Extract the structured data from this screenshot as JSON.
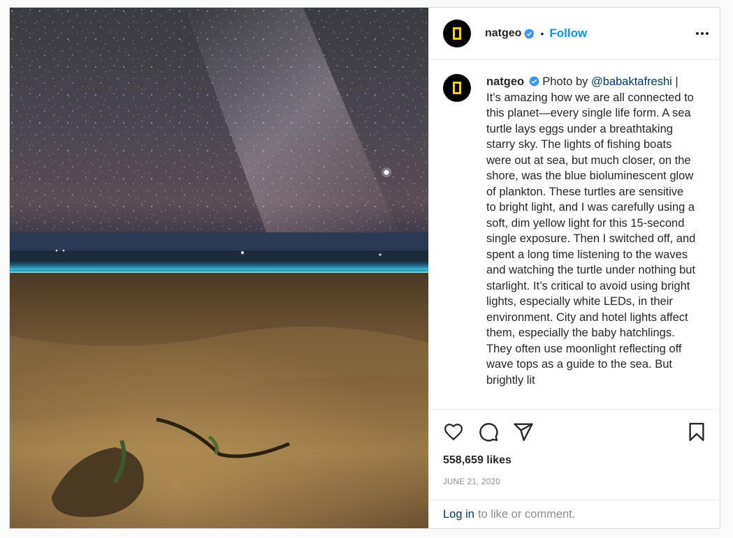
{
  "post": {
    "username": "natgeo",
    "follow_label": "Follow",
    "separator": "•",
    "caption": {
      "username": "natgeo",
      "prefix": "Photo by",
      "mention": "@babaktafreshi",
      "text": " | It’s amazing how we are all connected to this planet—every single life form. A sea turtle lays eggs under a breathtaking starry sky. The lights of fishing boats were out at sea, but much closer, on the shore, was the blue bioluminescent glow of plankton. These turtles are sensitive to bright light, and I was carefully using a soft, dim yellow light for this 15-second single exposure. Then I switched off, and spent a long time listening to the waves and watching the turtle under nothing but starlight. It’s critical to avoid using bright lights, especially white LEDs, in their environment. City and hotel lights affect them, especially the baby hatchlings. They often use moonlight reflecting off wave tops as a guide to the sea. But brightly lit"
    },
    "likes": "558,659 likes",
    "date": "JUNE 21, 2020",
    "login_link": "Log in",
    "login_suffix": "to like or comment."
  },
  "icons": {
    "avatar": "national-geographic-logo",
    "verified": "verified-badge-icon",
    "more": "more-options-icon",
    "like": "heart-icon",
    "comment": "comment-icon",
    "share": "share-icon",
    "save": "bookmark-icon"
  },
  "colors": {
    "accent": "#0095f6",
    "verified": "#3897f0",
    "logo_yellow": "#ffce00",
    "muted": "#8e8e8e",
    "link": "#00376b"
  }
}
